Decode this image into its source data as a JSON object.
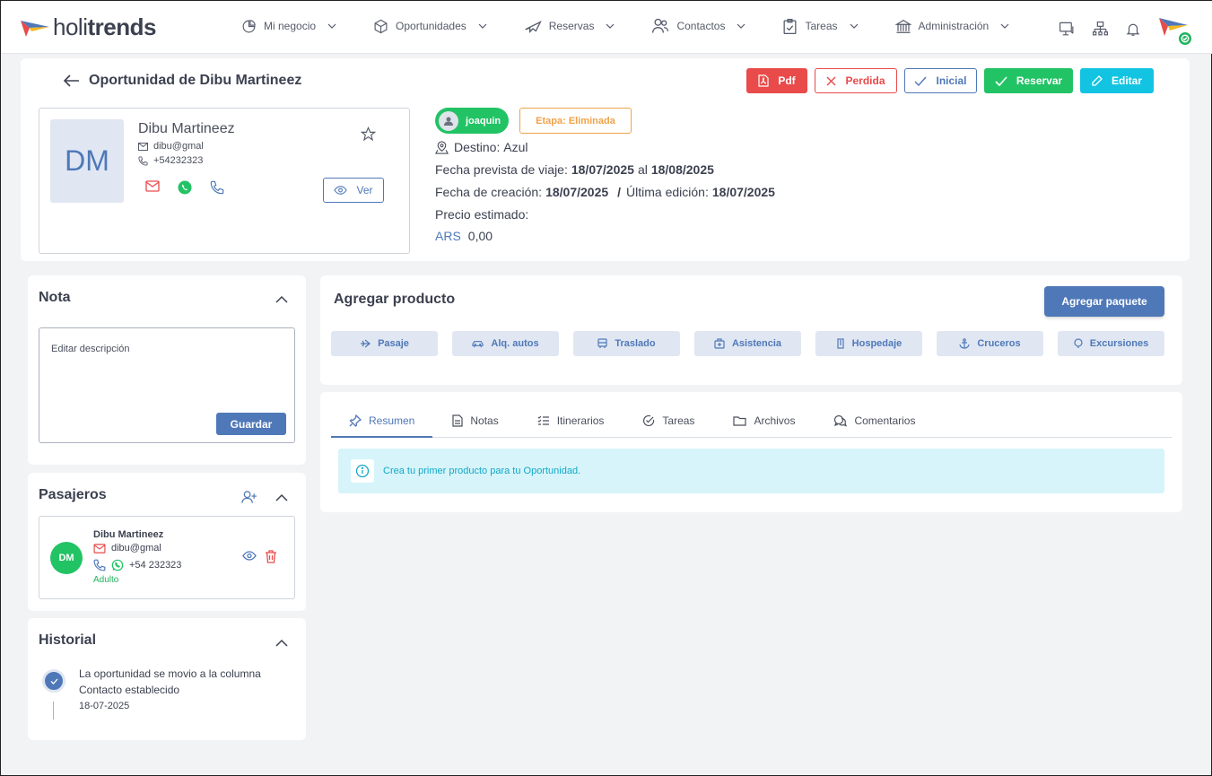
{
  "brand": {
    "prefix": "holi",
    "suffix": "trends"
  },
  "nav": [
    {
      "label": "Mi negocio",
      "icon": "pie-chart-icon"
    },
    {
      "label": "Oportunidades",
      "icon": "box-icon"
    },
    {
      "label": "Reservas",
      "icon": "plane-icon"
    },
    {
      "label": "Contactos",
      "icon": "users-icon"
    },
    {
      "label": "Tareas",
      "icon": "clipboard-icon"
    },
    {
      "label": "Administración",
      "icon": "bank-icon"
    }
  ],
  "header_icons": [
    "monitor-icon",
    "network-icon",
    "bell-icon",
    "app-logo-icon"
  ],
  "opportunity": {
    "title": "Oportunidad de Dibu Martineez",
    "actions": {
      "pdf": "Pdf",
      "perdida": "Perdida",
      "inicial": "Inicial",
      "reservar": "Reservar",
      "editar": "Editar"
    },
    "contact": {
      "initials": "DM",
      "name": "Dibu Martineez",
      "email": "dibu@gmal",
      "phone": "+54232323",
      "view": "Ver"
    },
    "owner": "joaquin",
    "stage": "Etapa: Eliminada",
    "destino_label": "Destino:",
    "destino": "Azul",
    "fecha_viaje_label": "Fecha prevista de viaje:",
    "fecha_desde": "18/07/2025",
    "fecha_al": "al",
    "fecha_hasta": "18/08/2025",
    "creacion_label": "Fecha de creación:",
    "creacion": "18/07/2025",
    "separator": "/",
    "edicion_label": "Última edición:",
    "edicion": "18/07/2025",
    "precio_label": "Precio estimado:",
    "currency": "ARS",
    "amount": "0,00"
  },
  "nota": {
    "title": "Nota",
    "placeholder": "Editar descripción",
    "save": "Guardar"
  },
  "pasajeros": {
    "title": "Pasajeros",
    "items": [
      {
        "initials": "DM",
        "name": "Dibu Martineez",
        "email": "dibu@gmal",
        "phone": "+54 232323",
        "type": "Adulto"
      }
    ]
  },
  "historial": {
    "title": "Historial",
    "items": [
      {
        "line1": "La oportunidad se movio a la columna",
        "line2": "Contacto establecido",
        "date": "18-07-2025"
      }
    ]
  },
  "agregar": {
    "title": "Agregar producto",
    "package_button": "Agregar paquete",
    "products": [
      "Pasaje",
      "Alq. autos",
      "Traslado",
      "Asistencia",
      "Hospedaje",
      "Cruceros",
      "Excursiones"
    ]
  },
  "tabs": [
    "Resumen",
    "Notas",
    "Itinerarios",
    "Tareas",
    "Archivos",
    "Comentarios"
  ],
  "active_tab": "Resumen",
  "alert": "Crea tu primer producto para tu Oportunidad.",
  "colors": {
    "primary": "#4f78b8",
    "danger": "#e94a4a",
    "success": "#22c365",
    "info": "#13c4e2",
    "warning": "#f0a24a"
  }
}
